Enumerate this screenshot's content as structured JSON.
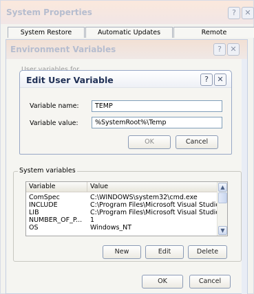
{
  "system_properties": {
    "title": "System Properties",
    "tabs": [
      "System Restore",
      "Automatic Updates",
      "Remote"
    ]
  },
  "env_vars": {
    "title": "Environment Variables",
    "user_vars_label_partial": "User variables for ...",
    "system_vars_label": "System variables",
    "columns": [
      "Variable",
      "Value"
    ],
    "rows": [
      {
        "variable": "ComSpec",
        "value": "C:\\WINDOWS\\system32\\cmd.exe"
      },
      {
        "variable": "INCLUDE",
        "value": "C:\\Program Files\\Microsoft Visual Studio..."
      },
      {
        "variable": "LIB",
        "value": "C:\\Program Files\\Microsoft Visual Studio..."
      },
      {
        "variable": "NUMBER_OF_P...",
        "value": "1"
      },
      {
        "variable": "OS",
        "value": "Windows_NT"
      }
    ],
    "new_label": "New",
    "edit_label": "Edit",
    "delete_label": "Delete",
    "ok_label": "OK",
    "cancel_label": "Cancel"
  },
  "edit_dialog": {
    "title": "Edit User Variable",
    "name_label": "Variable name:",
    "name_value": "TEMP",
    "value_label": "Variable value:",
    "value_value": "%SystemRoot%\\Temp",
    "ok_label": "OK",
    "cancel_label": "Cancel",
    "help_icon": "?",
    "close_icon": "✕"
  },
  "colors": {
    "title_text": "#b5bfd4",
    "dialog_title": "#1f2f55",
    "accent": "#f6c98e"
  }
}
